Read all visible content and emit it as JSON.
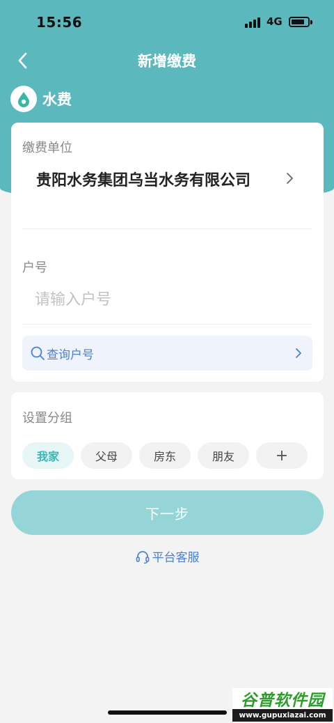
{
  "status_bar": {
    "time": "15:56",
    "network": "4G"
  },
  "nav": {
    "title": "新增缴费"
  },
  "service": {
    "name": "水费",
    "accent": "#3ab6a4"
  },
  "unit": {
    "label": "缴费单位",
    "value": "贵阳水务集团乌当水务有限公司"
  },
  "account": {
    "label": "户号",
    "placeholder": "请输入户号",
    "value": ""
  },
  "query": {
    "label": "查询户号"
  },
  "group": {
    "label": "设置分组",
    "chips": [
      "我家",
      "父母",
      "房东",
      "朋友"
    ],
    "selected": "我家",
    "add_symbol": "+"
  },
  "actions": {
    "next_label": "下一步",
    "service_label": "平台客服"
  },
  "colors": {
    "header_teal": "#5bb9be",
    "primary_disabled": "#96d5d7",
    "link_blue": "#4a7fd1"
  },
  "watermark": {
    "title": "谷普软件园",
    "url": "www.gupuxiazai.com"
  }
}
